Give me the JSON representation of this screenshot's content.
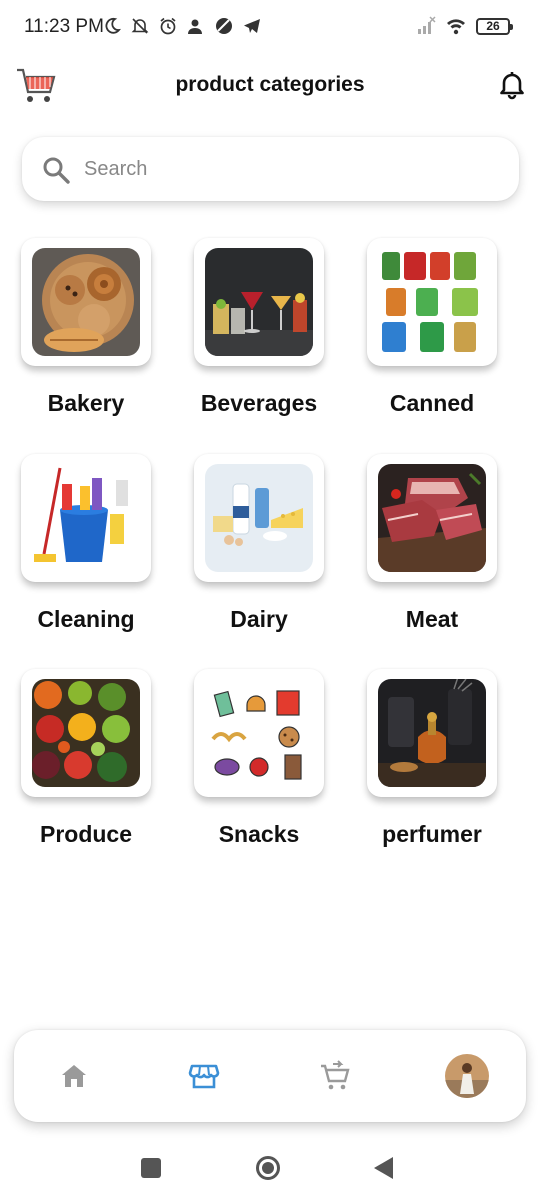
{
  "status_bar": {
    "time": "11:23 PM",
    "battery": "26"
  },
  "header": {
    "title": "product categories"
  },
  "search": {
    "placeholder": "Search"
  },
  "categories": [
    {
      "label": "Bakery"
    },
    {
      "label": "Beverages"
    },
    {
      "label": "Canned"
    },
    {
      "label": "Cleaning"
    },
    {
      "label": "Dairy"
    },
    {
      "label": "Meat"
    },
    {
      "label": "Produce"
    },
    {
      "label": "Snacks"
    },
    {
      "label": "perfumer"
    }
  ],
  "bottom_nav": {
    "items": [
      "home-icon",
      "store-icon",
      "cart-icon",
      "profile-avatar"
    ],
    "active": "store-icon",
    "active_color": "#3b8fd6",
    "inactive_color": "#9a9a9a"
  }
}
